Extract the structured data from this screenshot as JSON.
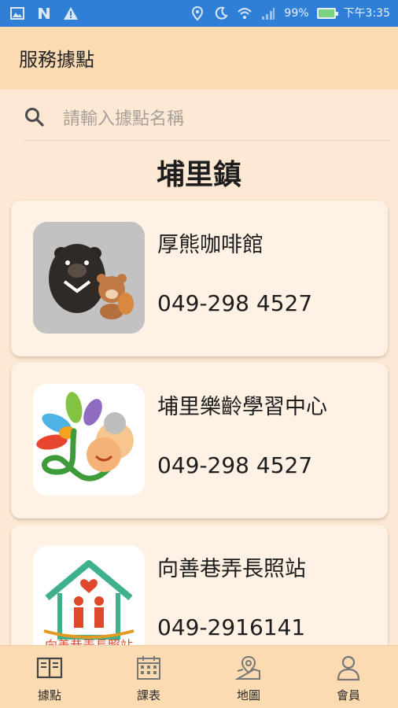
{
  "status_bar": {
    "battery": "99%",
    "time": "下午3:35"
  },
  "app_bar": {
    "title": "服務據點"
  },
  "search": {
    "placeholder": "請輸入據點名稱",
    "value": ""
  },
  "section": {
    "title": "埔里鎮"
  },
  "locations": [
    {
      "name": "厚熊咖啡館",
      "phone": "049-298 4527"
    },
    {
      "name": "埔里樂齡學習中心",
      "phone": "049-298 4527"
    },
    {
      "name": "向善巷弄長照站",
      "phone": "049-2916141",
      "logo_text": "向善巷弄長照站"
    }
  ],
  "bottom_nav": [
    {
      "label": "據點",
      "icon": "book-icon"
    },
    {
      "label": "課表",
      "icon": "calendar-icon"
    },
    {
      "label": "地圖",
      "icon": "map-icon"
    },
    {
      "label": "會員",
      "icon": "user-icon"
    }
  ],
  "colors": {
    "status_bar": "#2f7fd6",
    "app_bar": "#fcdab2",
    "background": "#fde9d3",
    "card": "#fff1e3"
  }
}
